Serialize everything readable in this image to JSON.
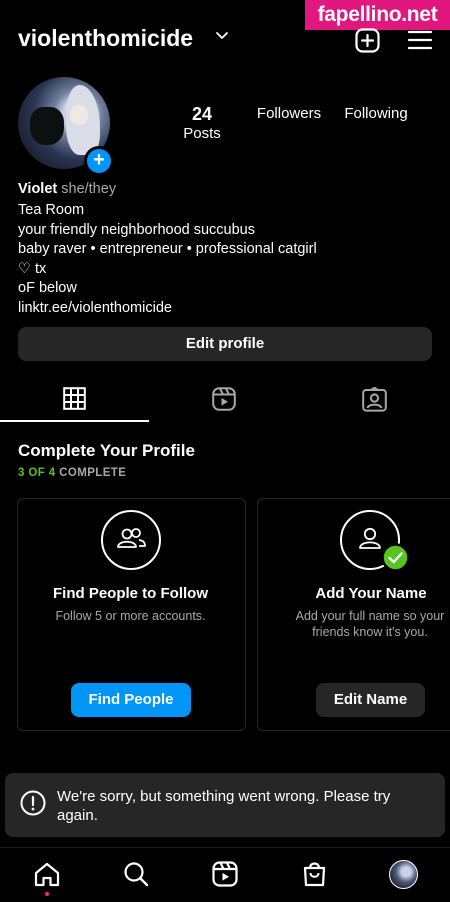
{
  "watermark": "fapellino.net",
  "header": {
    "username": "violenthomicide",
    "create_icon": "plus-square-icon",
    "menu_icon": "hamburger-menu-icon"
  },
  "profile": {
    "posts_count": "24",
    "posts_label": "Posts",
    "followers_label": "Followers",
    "following_label": "Following",
    "name": "Violet",
    "pronouns": "she/they",
    "category": "Tea Room",
    "bio_lines": [
      "your friendly neighborhood succubus",
      "baby raver • entrepreneur • professional catgirl",
      "♡ tx",
      "oF below",
      "linktr.ee/violenthomicide"
    ],
    "edit_profile_label": "Edit profile"
  },
  "tabs": [
    {
      "icon": "grid-icon",
      "active": true
    },
    {
      "icon": "reels-icon",
      "active": false
    },
    {
      "icon": "tagged-icon",
      "active": false
    }
  ],
  "complete_profile": {
    "title": "Complete Your Profile",
    "progress_done": "3 OF 4",
    "progress_label": "COMPLETE",
    "cards": [
      {
        "title": "Find People to Follow",
        "desc": "Follow 5 or more accounts.",
        "button": "Find People",
        "icon": "people-icon",
        "done": false
      },
      {
        "title": "Add Your Name",
        "desc": "Add your full name so your friends know it's you.",
        "button": "Edit Name",
        "icon": "person-icon",
        "done": true
      }
    ]
  },
  "toast": {
    "message": "We're sorry, but something went wrong. Please try again.",
    "icon": "alert-circle-icon"
  },
  "bottom_nav": [
    {
      "icon": "home-icon"
    },
    {
      "icon": "search-icon"
    },
    {
      "icon": "reels-icon"
    },
    {
      "icon": "shopping-bag-icon"
    },
    {
      "icon": "profile-avatar"
    }
  ],
  "colors": {
    "accent_blue": "#0095f6",
    "success_green": "#58c322",
    "surface": "#262626",
    "muted_text": "#a8a8a8",
    "watermark_bg": "#e0177f"
  }
}
